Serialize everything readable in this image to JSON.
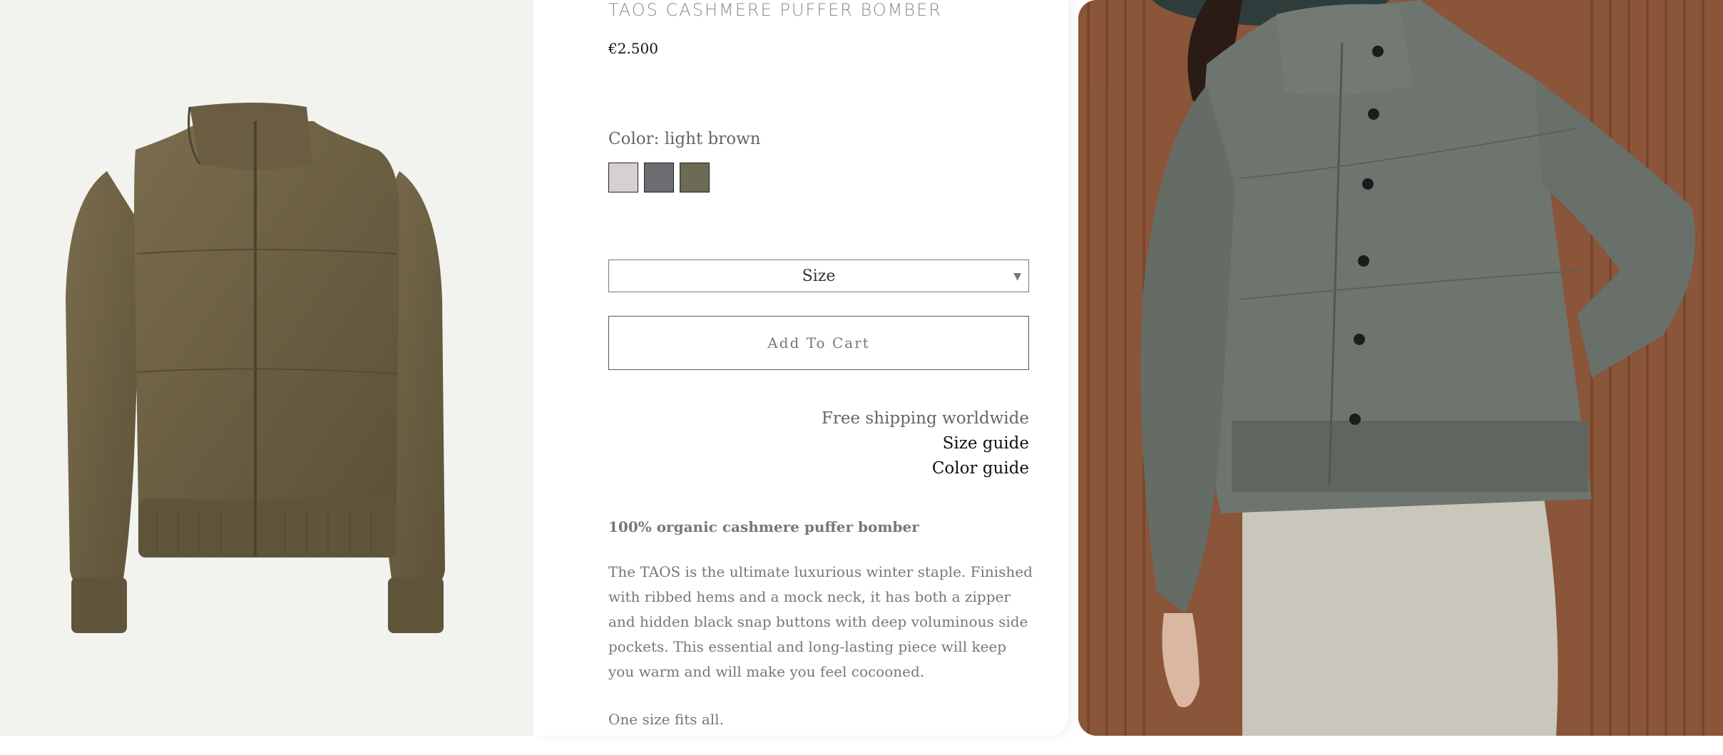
{
  "product": {
    "title": "TAOS CASHMERE PUFFER BOMBER",
    "price": "€2.500",
    "color_label": "Color: light brown",
    "swatches": [
      {
        "name": "light",
        "color": "#d8d0d0"
      },
      {
        "name": "grey",
        "color": "#6b6d70"
      },
      {
        "name": "olive",
        "color": "#6d6a55"
      }
    ],
    "size_placeholder": "Size",
    "add_to_cart": "Add To Cart"
  },
  "links": {
    "shipping": "Free shipping worldwide",
    "size_guide": "Size guide",
    "color_guide": "Color guide"
  },
  "description": {
    "headline": "100% organic cashmere puffer bomber",
    "body": "The TAOS is the ultimate luxurious winter staple. Finished with ribbed hems and a mock neck, it has both a zipper and hidden black snap buttons with deep voluminous side pockets. This essential and long-lasting piece will keep you warm and will make you feel cocooned.",
    "fit": "One size fits all."
  },
  "icons": {
    "size_caret": "caret-down-icon"
  },
  "colors": {
    "jacket_brown": "#6e6245",
    "jacket_green": "#6e756f",
    "wall": "#8a5538"
  }
}
